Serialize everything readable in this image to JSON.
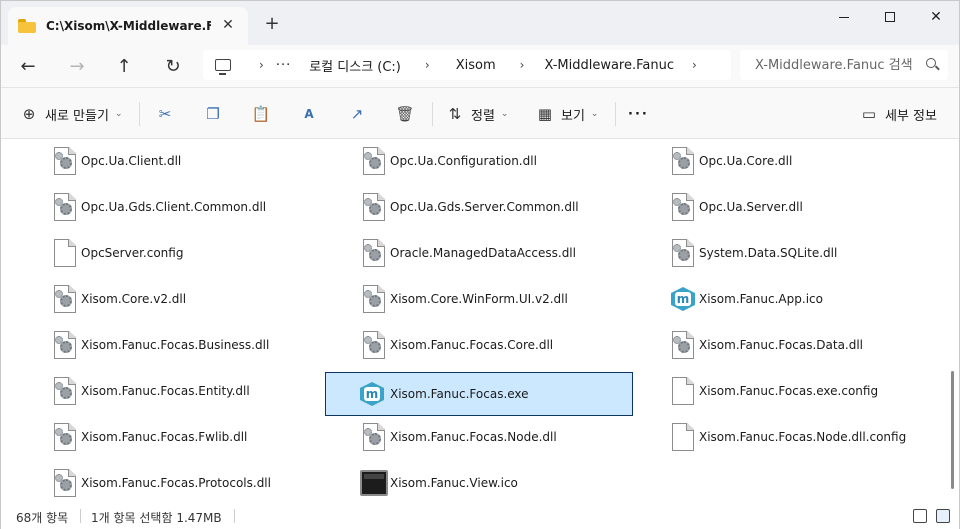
{
  "window": {
    "tab_title": "C:\\Xisom\\X-Middleware.Fanuc",
    "new_tab": "+",
    "minimize": "minimize",
    "maximize": "maximize",
    "close": "✕"
  },
  "nav": {
    "back": "←",
    "forward": "→",
    "up": "↑",
    "refresh": "↻",
    "breadcrumbs": [
      "로컬 디스크 (C:)",
      "Xisom",
      "X-Middleware.Fanuc"
    ],
    "more": "···",
    "search_placeholder": "X-Middleware.Fanuc 검색"
  },
  "toolbar": {
    "new_label": "새로 만들기",
    "sort_label": "정렬",
    "view_label": "보기",
    "more": "···",
    "details_label": "세부 정보"
  },
  "files": [
    {
      "name": "Opc.Ua.Client.dll",
      "icon": "dll-gear-icon"
    },
    {
      "name": "Opc.Ua.Configuration.dll",
      "icon": "dll-gear-icon"
    },
    {
      "name": "Opc.Ua.Core.dll",
      "icon": "dll-gear-icon"
    },
    {
      "name": "Opc.Ua.Gds.Client.Common.dll",
      "icon": "dll-gear-icon"
    },
    {
      "name": "Opc.Ua.Gds.Server.Common.dll",
      "icon": "dll-gear-icon"
    },
    {
      "name": "Opc.Ua.Server.dll",
      "icon": "dll-gear-icon"
    },
    {
      "name": "OpcServer.config",
      "icon": "blank-document-icon"
    },
    {
      "name": "Oracle.ManagedDataAccess.dll",
      "icon": "dll-gear-icon"
    },
    {
      "name": "System.Data.SQLite.dll",
      "icon": "dll-gear-icon"
    },
    {
      "name": "Xisom.Core.v2.dll",
      "icon": "dll-gear-icon"
    },
    {
      "name": "Xisom.Core.WinForm.UI.v2.dll",
      "icon": "dll-gear-icon"
    },
    {
      "name": "Xisom.Fanuc.App.ico",
      "icon": "xisom-logo-icon"
    },
    {
      "name": "Xisom.Fanuc.Focas.Business.dll",
      "icon": "dll-gear-icon"
    },
    {
      "name": "Xisom.Fanuc.Focas.Core.dll",
      "icon": "dll-gear-icon"
    },
    {
      "name": "Xisom.Fanuc.Focas.Data.dll",
      "icon": "dll-gear-icon"
    },
    {
      "name": "Xisom.Fanuc.Focas.Entity.dll",
      "icon": "dll-gear-icon"
    },
    {
      "name": "Xisom.Fanuc.Focas.exe",
      "icon": "xisom-logo-icon",
      "selected": true
    },
    {
      "name": "Xisom.Fanuc.Focas.exe.config",
      "icon": "blank-document-icon"
    },
    {
      "name": "Xisom.Fanuc.Focas.Fwlib.dll",
      "icon": "dll-gear-icon"
    },
    {
      "name": "Xisom.Fanuc.Focas.Node.dll",
      "icon": "dll-gear-icon"
    },
    {
      "name": "Xisom.Fanuc.Focas.Node.dll.config",
      "icon": "blank-document-icon"
    },
    {
      "name": "Xisom.Fanuc.Focas.Protocols.dll",
      "icon": "dll-gear-icon"
    },
    {
      "name": "Xisom.Fanuc.View.ico",
      "icon": "terminal-window-icon"
    }
  ],
  "status": {
    "item_count": "68개 항목",
    "selection": "1개 항목 선택함 1.47MB"
  }
}
